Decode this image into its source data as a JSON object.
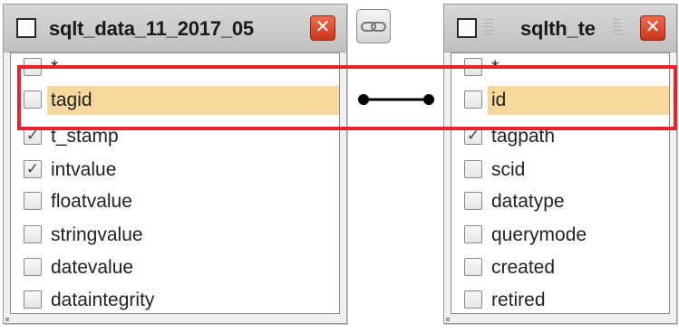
{
  "left_table": {
    "title": "sqlt_data_11_2017_05",
    "close_label": "✕",
    "columns": [
      {
        "label": "*",
        "checked": false
      },
      {
        "label": "tagid",
        "checked": false
      },
      {
        "label": "t_stamp",
        "checked": true
      },
      {
        "label": "intvalue",
        "checked": true
      },
      {
        "label": "floatvalue",
        "checked": false
      },
      {
        "label": "stringvalue",
        "checked": false
      },
      {
        "label": "datevalue",
        "checked": false
      },
      {
        "label": "dataintegrity",
        "checked": false
      }
    ]
  },
  "right_table": {
    "title": "sqlth_te",
    "close_label": "✕",
    "columns": [
      {
        "label": "*",
        "checked": false
      },
      {
        "label": "id",
        "checked": false
      },
      {
        "label": "tagpath",
        "checked": true
      },
      {
        "label": "scid",
        "checked": false
      },
      {
        "label": "datatype",
        "checked": false
      },
      {
        "label": "querymode",
        "checked": false
      },
      {
        "label": "created",
        "checked": false
      },
      {
        "label": "retired",
        "checked": false
      }
    ]
  },
  "join": {
    "left_column": "tagid",
    "right_column": "id"
  },
  "colors": {
    "highlight_row": "#f7d89c",
    "annotation_box": "#e8232b",
    "close_button": "#d8452a"
  },
  "icons": {
    "link_toggle": "chain-link-icon",
    "close": "close-icon"
  }
}
